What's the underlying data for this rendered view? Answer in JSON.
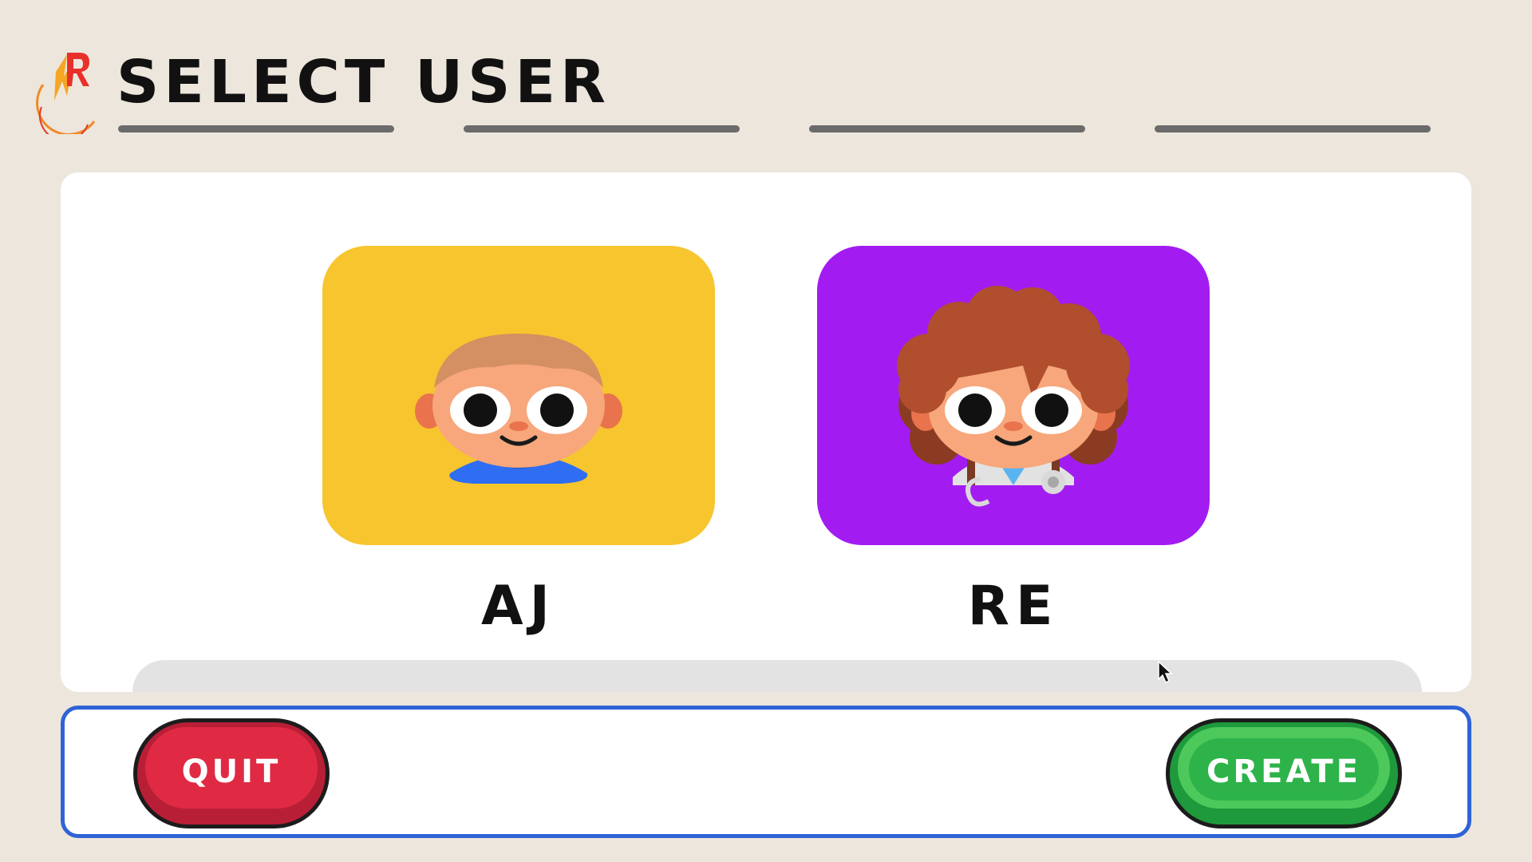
{
  "header": {
    "title": "SELECT USER",
    "logo_icon": "app-logo-icon",
    "progress_segments": 4
  },
  "users": [
    {
      "name": "AJ",
      "avatar_icon": "boy-avatar-icon",
      "card_color": "#f7c52e"
    },
    {
      "name": "RE",
      "avatar_icon": "doctor-avatar-icon",
      "card_color": "#a21cf1"
    }
  ],
  "actions": {
    "quit_label": "QUIT",
    "create_label": "CREATE"
  },
  "colors": {
    "background": "#ede6dc",
    "focus_border": "#2f63d6",
    "quit": "#e02a44",
    "create": "#4cc95a"
  }
}
